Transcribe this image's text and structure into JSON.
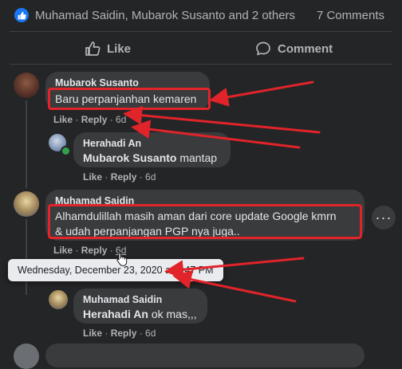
{
  "reactions": {
    "names": "Muhamad Saidin, Mubarok Susanto and 2 others",
    "comments_count": "7 Comments"
  },
  "actions": {
    "like": "Like",
    "comment": "Comment"
  },
  "comments": [
    {
      "author": "Mubarok Susanto",
      "text": "Baru perpanjanhan kemaren",
      "like": "Like",
      "reply": "Reply",
      "time": "6d",
      "reply_item": {
        "author": "Herahadi An",
        "tag": "Mubarok Susanto",
        "text": " mantap",
        "like": "Like",
        "reply": "Reply",
        "time": "6d"
      }
    },
    {
      "author": "Muhamad Saidin",
      "text_line1": "Alhamdulillah masih aman dari core update Google kmrn",
      "text_line2": "& udah perpanjangan PGP nya juga..",
      "like": "Like",
      "reply": "Reply",
      "time": "6d",
      "tooltip": "Wednesday, December 23, 2020 at 7:47 PM",
      "reply_item": {
        "author": "Muhamad Saidin",
        "tag": "Herahadi An",
        "text": " ok mas,,,",
        "like": "Like",
        "reply": "Reply",
        "time": "6d"
      }
    }
  ],
  "colors": {
    "highlight": "#e0242a",
    "accent": "#1877f2",
    "background": "#242526"
  }
}
